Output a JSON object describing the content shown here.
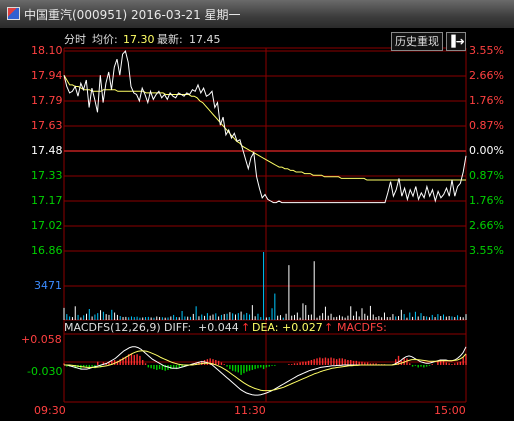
{
  "window": {
    "title": "中国重汽(000951) 2016-03-21 星期一"
  },
  "header": {
    "time_share_label": "分时",
    "avg_label": "均价:",
    "avg_value": "17.30",
    "latest_label": "最新:",
    "latest_value": "17.45",
    "history_button": "历史重现",
    "exit_icon": "exit-to-panel-icon"
  },
  "macd_header": {
    "label": "MACDFS(12,26,9)",
    "diff_label": "DIFF:",
    "diff_value": "+0.044",
    "dea_label": "DEA:",
    "dea_value": "+0.027",
    "macdfs_label": "MACDFS:",
    "arrow": "↑"
  },
  "colors": {
    "background": "#000000",
    "grid": "#8b0000",
    "up": "#ff3030",
    "down": "#00d000",
    "neutral": "#ffffff",
    "price_line": "#ffffff",
    "avg_line": "#ffff66",
    "volume": "#00c8ff",
    "axis_text_blue": "#3c8cff"
  },
  "chart_data": [
    {
      "type": "line",
      "x_ticks": [
        "09:30",
        "11:30",
        "15:00"
      ],
      "price_ticks": [
        "18.10",
        "17.94",
        "17.79",
        "17.63",
        "17.48",
        "17.33",
        "17.17",
        "17.02",
        "16.86"
      ],
      "pct_ticks": [
        "3.55%",
        "2.66%",
        "1.76%",
        "0.87%",
        "0.00%",
        "0.87%",
        "1.76%",
        "2.66%",
        "3.55%"
      ],
      "ylim": [
        16.86,
        18.1
      ],
      "prev_close": 17.48,
      "series": [
        {
          "name": "最新",
          "role": "price",
          "values": [
            17.95,
            17.88,
            17.84,
            17.85,
            17.88,
            17.82,
            17.9,
            17.86,
            17.92,
            17.75,
            17.87,
            17.8,
            17.72,
            17.95,
            17.78,
            17.9,
            17.97,
            17.86,
            18.0,
            18.05,
            17.95,
            18.08,
            18.1,
            18.03,
            17.88,
            17.84,
            17.83,
            17.79,
            17.87,
            17.83,
            17.78,
            17.85,
            17.8,
            17.83,
            17.85,
            17.81,
            17.83,
            17.8,
            17.84,
            17.82,
            17.81,
            17.84,
            17.83,
            17.82,
            17.84,
            17.83,
            17.86,
            17.85,
            17.89,
            17.84,
            17.87,
            17.82,
            17.83,
            17.85,
            17.75,
            17.78,
            17.64,
            17.69,
            17.58,
            17.61,
            17.56,
            17.59,
            17.54,
            17.55,
            17.49,
            17.43,
            17.37,
            17.44,
            17.47,
            17.32,
            17.25,
            17.19,
            17.21,
            17.18,
            17.17,
            17.16,
            17.16,
            17.17,
            17.16,
            17.16,
            17.16,
            17.16,
            17.16,
            17.16,
            17.16,
            17.16,
            17.16,
            17.16,
            17.16,
            17.16,
            17.16,
            17.16,
            17.16,
            17.16,
            17.16,
            17.16,
            17.16,
            17.16,
            17.16,
            17.16,
            17.16,
            17.16,
            17.16,
            17.16,
            17.16,
            17.16,
            17.16,
            17.16,
            17.16,
            17.16,
            17.16,
            17.16,
            17.16,
            17.16,
            17.16,
            17.16,
            17.22,
            17.29,
            17.2,
            17.24,
            17.31,
            17.2,
            17.25,
            17.18,
            17.24,
            17.2,
            17.26,
            17.18,
            17.22,
            17.19,
            17.26,
            17.2,
            17.24,
            17.17,
            17.23,
            17.19,
            17.21,
            17.25,
            17.2,
            17.3,
            17.2,
            17.26,
            17.28,
            17.35,
            17.45
          ]
        },
        {
          "name": "均价",
          "role": "average",
          "values": [
            17.95,
            17.92,
            17.89,
            17.89,
            17.88,
            17.88,
            17.87,
            17.86,
            17.86,
            17.86,
            17.85,
            17.85,
            17.85,
            17.85,
            17.86,
            17.86,
            17.86,
            17.86,
            17.86,
            17.85,
            17.85,
            17.85,
            17.85,
            17.85,
            17.85,
            17.85,
            17.85,
            17.85,
            17.85,
            17.84,
            17.84,
            17.84,
            17.84,
            17.84,
            17.84,
            17.84,
            17.83,
            17.83,
            17.83,
            17.83,
            17.83,
            17.83,
            17.83,
            17.83,
            17.83,
            17.82,
            17.82,
            17.81,
            17.79,
            17.78,
            17.76,
            17.74,
            17.72,
            17.7,
            17.68,
            17.66,
            17.64,
            17.62,
            17.6,
            17.58,
            17.56,
            17.54,
            17.53,
            17.51,
            17.5,
            17.49,
            17.48,
            17.47,
            17.46,
            17.45,
            17.44,
            17.43,
            17.42,
            17.41,
            17.4,
            17.39,
            17.38,
            17.38,
            17.37,
            17.37,
            17.36,
            17.36,
            17.35,
            17.35,
            17.35,
            17.34,
            17.34,
            17.34,
            17.33,
            17.33,
            17.33,
            17.33,
            17.32,
            17.32,
            17.32,
            17.32,
            17.32,
            17.32,
            17.31,
            17.31,
            17.31,
            17.31,
            17.31,
            17.31,
            17.31,
            17.31,
            17.31,
            17.3,
            17.3,
            17.3,
            17.3,
            17.3,
            17.3,
            17.3,
            17.3,
            17.3,
            17.3,
            17.3,
            17.3,
            17.3,
            17.3,
            17.3,
            17.3,
            17.3,
            17.3,
            17.3,
            17.3,
            17.3,
            17.3,
            17.3,
            17.3,
            17.3,
            17.3,
            17.3,
            17.3,
            17.3,
            17.3,
            17.3,
            17.3,
            17.3,
            17.3,
            17.3,
            17.3
          ]
        }
      ]
    },
    {
      "type": "bar",
      "name": "volume",
      "axis_label": "3471",
      "ymax": 3471,
      "values": [
        620,
        300,
        180,
        150,
        700,
        260,
        130,
        240,
        320,
        560,
        180,
        280,
        350,
        500,
        420,
        300,
        260,
        520,
        380,
        260,
        200,
        150,
        160,
        140,
        180,
        150,
        170,
        120,
        130,
        150,
        160,
        130,
        120,
        180,
        150,
        140,
        120,
        130,
        180,
        260,
        150,
        140,
        460,
        180,
        170,
        160,
        310,
        700,
        190,
        280,
        210,
        350,
        220,
        280,
        340,
        180,
        260,
        300,
        320,
        400,
        340,
        280,
        350,
        430,
        280,
        360,
        280,
        760,
        190,
        320,
        150,
        3470,
        130,
        150,
        600,
        1350,
        220,
        250,
        120,
        320,
        2800,
        220,
        260,
        380,
        120,
        850,
        760,
        260,
        280,
        3000,
        120,
        220,
        350,
        680,
        220,
        320,
        140,
        160,
        240,
        180,
        120,
        220,
        700,
        220,
        440,
        180,
        600,
        320,
        220,
        720,
        280,
        150,
        200,
        140,
        380,
        150,
        150,
        300,
        180,
        200,
        520,
        300,
        120,
        380,
        160,
        420,
        180,
        350,
        200,
        180,
        140,
        260,
        150,
        300,
        200,
        280,
        170,
        200,
        180,
        150,
        240,
        160,
        140,
        300
      ]
    },
    {
      "type": "bar",
      "name": "MACDFS",
      "axis_ticks": [
        "+0.058",
        "-0.030"
      ],
      "ylim": [
        -0.08,
        0.075
      ],
      "histogram": [
        0.004,
        -0.004,
        -0.004,
        -0.004,
        -0.008,
        -0.006,
        -0.01,
        -0.004,
        -0.006,
        -0.01,
        -0.004,
        -0.008,
        0.008,
        -0.006,
        0.006,
        0.004,
        0.006,
        0.01,
        0.012,
        0.01,
        0.014,
        0.018,
        0.02,
        0.026,
        0.028,
        0.024,
        0.026,
        0.022,
        0.012,
        0.004,
        -0.006,
        -0.008,
        -0.01,
        -0.012,
        -0.01,
        -0.012,
        -0.014,
        -0.012,
        -0.01,
        -0.008,
        -0.01,
        -0.008,
        -0.004,
        -0.004,
        -0.002,
        0.0,
        0.004,
        0.006,
        0.008,
        0.01,
        0.012,
        0.014,
        0.016,
        0.014,
        0.012,
        0.01,
        0.006,
        0.002,
        -0.004,
        -0.01,
        -0.014,
        -0.016,
        -0.018,
        -0.024,
        -0.02,
        -0.016,
        -0.014,
        -0.012,
        -0.01,
        -0.008,
        -0.006,
        -0.01,
        -0.006,
        -0.004,
        -0.002,
        -0.002,
        0.0,
        0.0,
        0.0,
        0.0,
        0.002,
        0.002,
        0.004,
        0.004,
        0.006,
        0.008,
        0.008,
        0.01,
        0.012,
        0.014,
        0.016,
        0.018,
        0.016,
        0.018,
        0.016,
        0.018,
        0.016,
        0.014,
        0.016,
        0.016,
        0.014,
        0.012,
        0.012,
        0.01,
        0.01,
        0.008,
        0.008,
        0.006,
        0.006,
        0.004,
        0.004,
        0.004,
        0.002,
        0.002,
        0.002,
        0.0,
        0.0,
        0.0,
        0.014,
        0.022,
        0.01,
        0.018,
        0.016,
        0.004,
        -0.004,
        -0.002,
        -0.006,
        -0.004,
        -0.006,
        -0.004,
        -0.002,
        0.002,
        0.0,
        0.01,
        0.012,
        0.01,
        0.006,
        0.004,
        0.002,
        0.004,
        0.006,
        0.008,
        0.018,
        0.026
      ],
      "series": [
        {
          "name": "DIFF",
          "values": [
            0.0,
            0.0,
            -0.002,
            -0.004,
            -0.006,
            -0.008,
            -0.01,
            -0.01,
            -0.01,
            -0.008,
            -0.006,
            -0.004,
            -0.002,
            0.0,
            0.002,
            0.004,
            0.008,
            0.012,
            0.016,
            0.022,
            0.028,
            0.034,
            0.038,
            0.042,
            0.044,
            0.044,
            0.042,
            0.038,
            0.032,
            0.026,
            0.02,
            0.014,
            0.01,
            0.006,
            0.002,
            -0.002,
            -0.004,
            -0.006,
            -0.008,
            -0.008,
            -0.008,
            -0.006,
            -0.004,
            -0.002,
            0.0,
            0.002,
            0.004,
            0.006,
            0.008,
            0.008,
            0.006,
            0.004,
            0.0,
            -0.006,
            -0.012,
            -0.018,
            -0.024,
            -0.03,
            -0.036,
            -0.042,
            -0.048,
            -0.054,
            -0.06,
            -0.064,
            -0.068,
            -0.07,
            -0.072,
            -0.073,
            -0.073,
            -0.072,
            -0.07,
            -0.068,
            -0.065,
            -0.062,
            -0.058,
            -0.054,
            -0.05,
            -0.046,
            -0.042,
            -0.038,
            -0.034,
            -0.03,
            -0.026,
            -0.023,
            -0.02,
            -0.017,
            -0.014,
            -0.012,
            -0.01,
            -0.008,
            -0.006,
            -0.005,
            -0.004,
            -0.003,
            -0.002,
            -0.002,
            -0.001,
            -0.001,
            0.0,
            0.0,
            0.0,
            0.0,
            0.0,
            0.0,
            0.0,
            0.0,
            0.0,
            0.0,
            0.0,
            0.0,
            0.0,
            0.0,
            0.0,
            0.0,
            0.0,
            0.0,
            0.002,
            0.006,
            0.01,
            0.016,
            0.02,
            0.022,
            0.02,
            0.016,
            0.012,
            0.008,
            0.006,
            0.004,
            0.004,
            0.006,
            0.008,
            0.01,
            0.012,
            0.012,
            0.012,
            0.01,
            0.01,
            0.012,
            0.016,
            0.022,
            0.03,
            0.044
          ]
        },
        {
          "name": "DEA",
          "values": [
            0.0,
            0.0,
            0.0,
            -0.001,
            -0.002,
            -0.003,
            -0.004,
            -0.005,
            -0.006,
            -0.006,
            -0.006,
            -0.006,
            -0.005,
            -0.004,
            -0.003,
            -0.002,
            0.0,
            0.002,
            0.005,
            0.008,
            0.012,
            0.016,
            0.02,
            0.024,
            0.028,
            0.031,
            0.033,
            0.034,
            0.034,
            0.033,
            0.031,
            0.028,
            0.025,
            0.022,
            0.018,
            0.015,
            0.012,
            0.009,
            0.006,
            0.004,
            0.002,
            0.001,
            0.0,
            0.0,
            0.0,
            0.0,
            0.001,
            0.002,
            0.003,
            0.004,
            0.004,
            0.004,
            0.003,
            0.001,
            -0.002,
            -0.005,
            -0.009,
            -0.013,
            -0.018,
            -0.023,
            -0.028,
            -0.033,
            -0.038,
            -0.043,
            -0.047,
            -0.051,
            -0.054,
            -0.057,
            -0.059,
            -0.061,
            -0.062,
            -0.062,
            -0.062,
            -0.061,
            -0.06,
            -0.058,
            -0.056,
            -0.054,
            -0.051,
            -0.048,
            -0.045,
            -0.042,
            -0.039,
            -0.036,
            -0.033,
            -0.03,
            -0.027,
            -0.024,
            -0.021,
            -0.019,
            -0.016,
            -0.014,
            -0.012,
            -0.01,
            -0.008,
            -0.007,
            -0.006,
            -0.005,
            -0.004,
            -0.003,
            -0.002,
            -0.002,
            -0.001,
            -0.001,
            0.0,
            0.0,
            0.0,
            0.0,
            0.0,
            0.0,
            0.0,
            0.0,
            0.0,
            0.0,
            0.0,
            0.0,
            0.001,
            0.002,
            0.004,
            0.006,
            0.009,
            0.011,
            0.013,
            0.013,
            0.013,
            0.012,
            0.011,
            0.01,
            0.009,
            0.009,
            0.009,
            0.009,
            0.01,
            0.01,
            0.01,
            0.01,
            0.01,
            0.011,
            0.012,
            0.015,
            0.019,
            0.027
          ]
        }
      ]
    }
  ]
}
